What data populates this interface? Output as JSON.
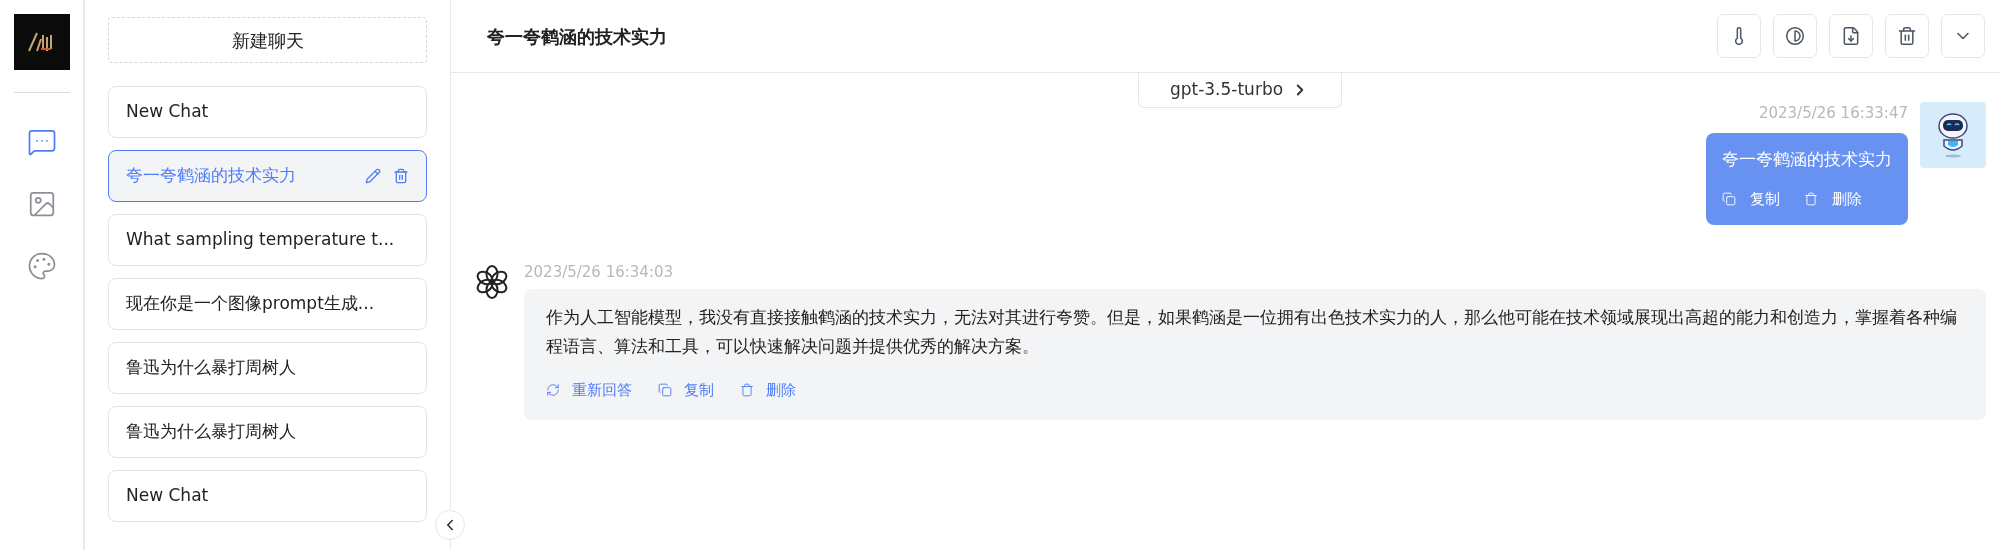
{
  "rail": {
    "items": [
      {
        "kind": "chat",
        "selected": true
      },
      {
        "kind": "image",
        "selected": false
      },
      {
        "kind": "palette",
        "selected": false
      }
    ]
  },
  "chat_list": {
    "new_chat": "新建聊天",
    "items": [
      {
        "title": "New Chat",
        "selected": false
      },
      {
        "title": "夸一夸鹤涵的技术实力",
        "selected": true
      },
      {
        "title": "What sampling temperature t...",
        "selected": false
      },
      {
        "title": "现在你是一个图像prompt生成...",
        "selected": false
      },
      {
        "title": "鲁迅为什么暴打周树人",
        "selected": false
      },
      {
        "title": "鲁迅为什么暴打周树人",
        "selected": false
      },
      {
        "title": "New Chat",
        "selected": false
      }
    ]
  },
  "header": {
    "title": "夸一夸鹤涵的技术实力",
    "tools": [
      {
        "kind": "temperature"
      },
      {
        "kind": "theme"
      },
      {
        "kind": "export"
      },
      {
        "kind": "delete"
      },
      {
        "kind": "more"
      }
    ]
  },
  "model": "gpt-3.5-turbo",
  "messages": [
    {
      "kind": "user",
      "time": "2023/5/26 16:33:47",
      "text": "夸一夸鹤涵的技术实力",
      "actions": [
        {
          "kind": "copy",
          "label": "复制"
        },
        {
          "kind": "delete",
          "label": "删除"
        }
      ]
    },
    {
      "kind": "assistant",
      "time": "2023/5/26 16:34:03",
      "text": "作为人工智能模型，我没有直接接触鹤涵的技术实力，无法对其进行夸赞。但是，如果鹤涵是一位拥有出色技术实力的人，那么他可能在技术领域展现出高超的能力和创造力，掌握着各种编程语言、算法和工具，可以快速解决问题并提供优秀的解决方案。",
      "actions": [
        {
          "kind": "regenerate",
          "label": "重新回答"
        },
        {
          "kind": "copy",
          "label": "复制"
        },
        {
          "kind": "delete",
          "label": "删除"
        }
      ]
    }
  ]
}
